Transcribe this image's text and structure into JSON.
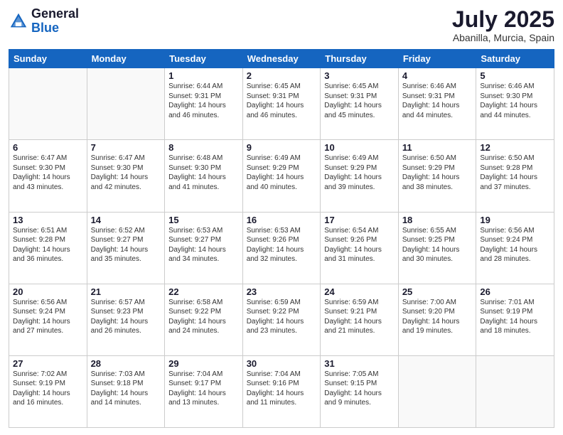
{
  "header": {
    "logo_general": "General",
    "logo_blue": "Blue",
    "month_title": "July 2025",
    "location": "Abanilla, Murcia, Spain"
  },
  "days_of_week": [
    "Sunday",
    "Monday",
    "Tuesday",
    "Wednesday",
    "Thursday",
    "Friday",
    "Saturday"
  ],
  "weeks": [
    [
      {
        "day": "",
        "info": ""
      },
      {
        "day": "",
        "info": ""
      },
      {
        "day": "1",
        "info": "Sunrise: 6:44 AM\nSunset: 9:31 PM\nDaylight: 14 hours and 46 minutes."
      },
      {
        "day": "2",
        "info": "Sunrise: 6:45 AM\nSunset: 9:31 PM\nDaylight: 14 hours and 46 minutes."
      },
      {
        "day": "3",
        "info": "Sunrise: 6:45 AM\nSunset: 9:31 PM\nDaylight: 14 hours and 45 minutes."
      },
      {
        "day": "4",
        "info": "Sunrise: 6:46 AM\nSunset: 9:31 PM\nDaylight: 14 hours and 44 minutes."
      },
      {
        "day": "5",
        "info": "Sunrise: 6:46 AM\nSunset: 9:30 PM\nDaylight: 14 hours and 44 minutes."
      }
    ],
    [
      {
        "day": "6",
        "info": "Sunrise: 6:47 AM\nSunset: 9:30 PM\nDaylight: 14 hours and 43 minutes."
      },
      {
        "day": "7",
        "info": "Sunrise: 6:47 AM\nSunset: 9:30 PM\nDaylight: 14 hours and 42 minutes."
      },
      {
        "day": "8",
        "info": "Sunrise: 6:48 AM\nSunset: 9:30 PM\nDaylight: 14 hours and 41 minutes."
      },
      {
        "day": "9",
        "info": "Sunrise: 6:49 AM\nSunset: 9:29 PM\nDaylight: 14 hours and 40 minutes."
      },
      {
        "day": "10",
        "info": "Sunrise: 6:49 AM\nSunset: 9:29 PM\nDaylight: 14 hours and 39 minutes."
      },
      {
        "day": "11",
        "info": "Sunrise: 6:50 AM\nSunset: 9:29 PM\nDaylight: 14 hours and 38 minutes."
      },
      {
        "day": "12",
        "info": "Sunrise: 6:50 AM\nSunset: 9:28 PM\nDaylight: 14 hours and 37 minutes."
      }
    ],
    [
      {
        "day": "13",
        "info": "Sunrise: 6:51 AM\nSunset: 9:28 PM\nDaylight: 14 hours and 36 minutes."
      },
      {
        "day": "14",
        "info": "Sunrise: 6:52 AM\nSunset: 9:27 PM\nDaylight: 14 hours and 35 minutes."
      },
      {
        "day": "15",
        "info": "Sunrise: 6:53 AM\nSunset: 9:27 PM\nDaylight: 14 hours and 34 minutes."
      },
      {
        "day": "16",
        "info": "Sunrise: 6:53 AM\nSunset: 9:26 PM\nDaylight: 14 hours and 32 minutes."
      },
      {
        "day": "17",
        "info": "Sunrise: 6:54 AM\nSunset: 9:26 PM\nDaylight: 14 hours and 31 minutes."
      },
      {
        "day": "18",
        "info": "Sunrise: 6:55 AM\nSunset: 9:25 PM\nDaylight: 14 hours and 30 minutes."
      },
      {
        "day": "19",
        "info": "Sunrise: 6:56 AM\nSunset: 9:24 PM\nDaylight: 14 hours and 28 minutes."
      }
    ],
    [
      {
        "day": "20",
        "info": "Sunrise: 6:56 AM\nSunset: 9:24 PM\nDaylight: 14 hours and 27 minutes."
      },
      {
        "day": "21",
        "info": "Sunrise: 6:57 AM\nSunset: 9:23 PM\nDaylight: 14 hours and 26 minutes."
      },
      {
        "day": "22",
        "info": "Sunrise: 6:58 AM\nSunset: 9:22 PM\nDaylight: 14 hours and 24 minutes."
      },
      {
        "day": "23",
        "info": "Sunrise: 6:59 AM\nSunset: 9:22 PM\nDaylight: 14 hours and 23 minutes."
      },
      {
        "day": "24",
        "info": "Sunrise: 6:59 AM\nSunset: 9:21 PM\nDaylight: 14 hours and 21 minutes."
      },
      {
        "day": "25",
        "info": "Sunrise: 7:00 AM\nSunset: 9:20 PM\nDaylight: 14 hours and 19 minutes."
      },
      {
        "day": "26",
        "info": "Sunrise: 7:01 AM\nSunset: 9:19 PM\nDaylight: 14 hours and 18 minutes."
      }
    ],
    [
      {
        "day": "27",
        "info": "Sunrise: 7:02 AM\nSunset: 9:19 PM\nDaylight: 14 hours and 16 minutes."
      },
      {
        "day": "28",
        "info": "Sunrise: 7:03 AM\nSunset: 9:18 PM\nDaylight: 14 hours and 14 minutes."
      },
      {
        "day": "29",
        "info": "Sunrise: 7:04 AM\nSunset: 9:17 PM\nDaylight: 14 hours and 13 minutes."
      },
      {
        "day": "30",
        "info": "Sunrise: 7:04 AM\nSunset: 9:16 PM\nDaylight: 14 hours and 11 minutes."
      },
      {
        "day": "31",
        "info": "Sunrise: 7:05 AM\nSunset: 9:15 PM\nDaylight: 14 hours and 9 minutes."
      },
      {
        "day": "",
        "info": ""
      },
      {
        "day": "",
        "info": ""
      }
    ]
  ]
}
